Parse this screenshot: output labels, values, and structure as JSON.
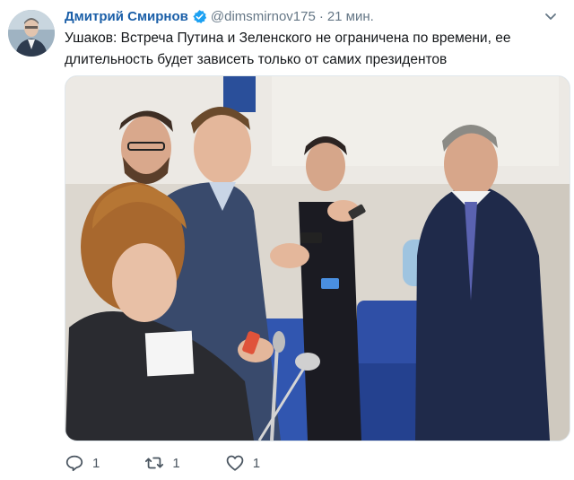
{
  "author": {
    "name": "Дмитрий Смирнов",
    "handle": "@dimsmirnov175",
    "separator": "·",
    "time": "21 мин."
  },
  "tweet": {
    "text": "Ушаков: Встреча Путина и Зеленского не ограничена по времени, ее длительность будет зависеть только от самих президентов"
  },
  "icons": {
    "avatar": "avatar-photo",
    "verified": "verified-badge-icon",
    "more": "chevron-down-icon",
    "reply": "reply-icon",
    "retweet": "retweet-icon",
    "like": "heart-icon"
  },
  "actions": {
    "reply_count": "1",
    "retweet_count": "1",
    "like_count": "1"
  },
  "colors": {
    "name": "#1b5fa8",
    "verified": "#1da1f2",
    "secondary_text": "#657786"
  }
}
